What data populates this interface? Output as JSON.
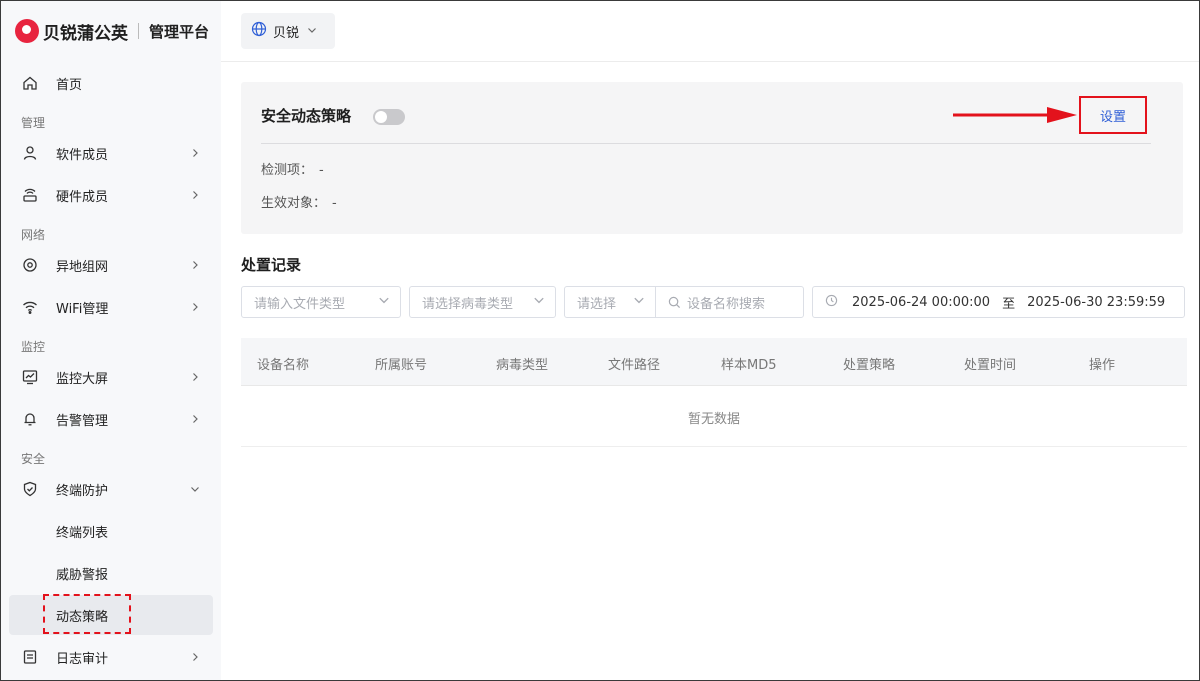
{
  "brand": {
    "name": "贝锐蒲公英",
    "subtitle": "管理平台"
  },
  "header": {
    "org_label": "贝锐"
  },
  "sidebar": {
    "home": "首页",
    "sections": {
      "manage": "管理",
      "network": "网络",
      "monitor": "监控",
      "security": "安全"
    },
    "items": {
      "software_members": "软件成员",
      "hardware_members": "硬件成员",
      "remote_network": "异地组网",
      "wifi": "WiFi管理",
      "monitor_screen": "监控大屏",
      "alarm": "告警管理",
      "endpoint_protection": "终端防护",
      "endpoint_list": "终端列表",
      "threat_alert": "威胁警报",
      "dynamic_policy": "动态策略",
      "log_audit": "日志审计"
    }
  },
  "policy": {
    "title": "安全动态策略",
    "enabled": false,
    "settings_label": "设置",
    "detect_label": "检测项：",
    "detect_value": "-",
    "target_label": "生效对象：",
    "target_value": "-"
  },
  "records": {
    "title": "处置记录",
    "filters": {
      "file_type_placeholder": "请输入文件类型",
      "virus_type_placeholder": "请选择病毒类型",
      "select_placeholder": "请选择",
      "device_search_placeholder": "设备名称搜索",
      "date_start": "2025-06-24 00:00:00",
      "date_to": "至",
      "date_end": "2025-06-30 23:59:59"
    },
    "columns": [
      "设备名称",
      "所属账号",
      "病毒类型",
      "文件路径",
      "样本MD5",
      "处置策略",
      "处置时间",
      "操作"
    ],
    "empty_text": "暂无数据"
  },
  "colors": {
    "accent": "#2f5fd6",
    "highlight": "#e3121c",
    "brand": "#e8243f"
  }
}
